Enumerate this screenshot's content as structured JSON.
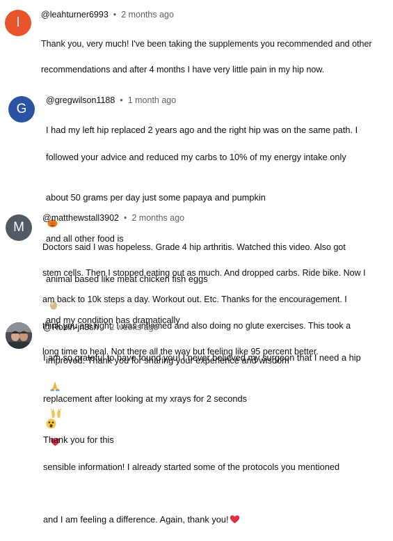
{
  "comments": [
    {
      "avatar_letter": "l",
      "avatar_color": "#e8542b",
      "handle": "@leahturner6993",
      "time": "2 months ago",
      "text_lines": [
        "Thank you, very much!   I've been taking the supplements you recommended and other",
        "recommendations and after 4 months I have very little pain in my hip now."
      ]
    },
    {
      "avatar_letter": "G",
      "avatar_color": "#2b53a5",
      "handle": "@gregwilson1188",
      "time": "1 month ago",
      "text_lines": [
        "I had my left hip replaced 2 years ago and the right hip was on the same path.  I",
        "followed your advice and reduced my carbs to 10% of my energy intake only",
        "about 50 grams per day just some papaya and pumpkin",
        "and all other food is",
        "animal based like meat chicken fish eggs",
        "and my condition has dramatically",
        "improved.   Thank you for sharing your experience and wisdom"
      ],
      "emojis": [
        "pumpkin",
        "egg",
        "folded-hands",
        "raised-hands",
        "red-heart"
      ]
    },
    {
      "avatar_letter": "M",
      "avatar_color": "#525a66",
      "handle": "@matthewstall3902",
      "time": "2 months ago",
      "text_lines": [
        "Doctors said I was hopeless. Grade 4 hip arthritis. Watched this video. Also got",
        "stem cells. Then I stopped eating out as much. And dropped carbs. Ride bike. Now I",
        "am back to 10k steps a day. Workout out. Etc. Thanks for the encouragement. I",
        "think you are right. I was inflamed and also doing no glute exercises. This took a",
        "long time to heal. Not there all the way but feeling like 95 percent better."
      ]
    },
    {
      "avatar_type": "photo",
      "handle": "@Robin-jn3sh",
      "time": "2 weeks ago",
      "text_lines": [
        "I am so grateful to have found you!  I never believed my surgeon that I need a hip",
        "replacement after looking at my xrays for 2 seconds",
        "Thank you for this",
        "sensible information!  I already started some of the protocols you mentioned",
        "and I am feeling a difference.  Again, thank you!"
      ],
      "emojis": [
        "astonished-face",
        "red-heart"
      ]
    }
  ]
}
